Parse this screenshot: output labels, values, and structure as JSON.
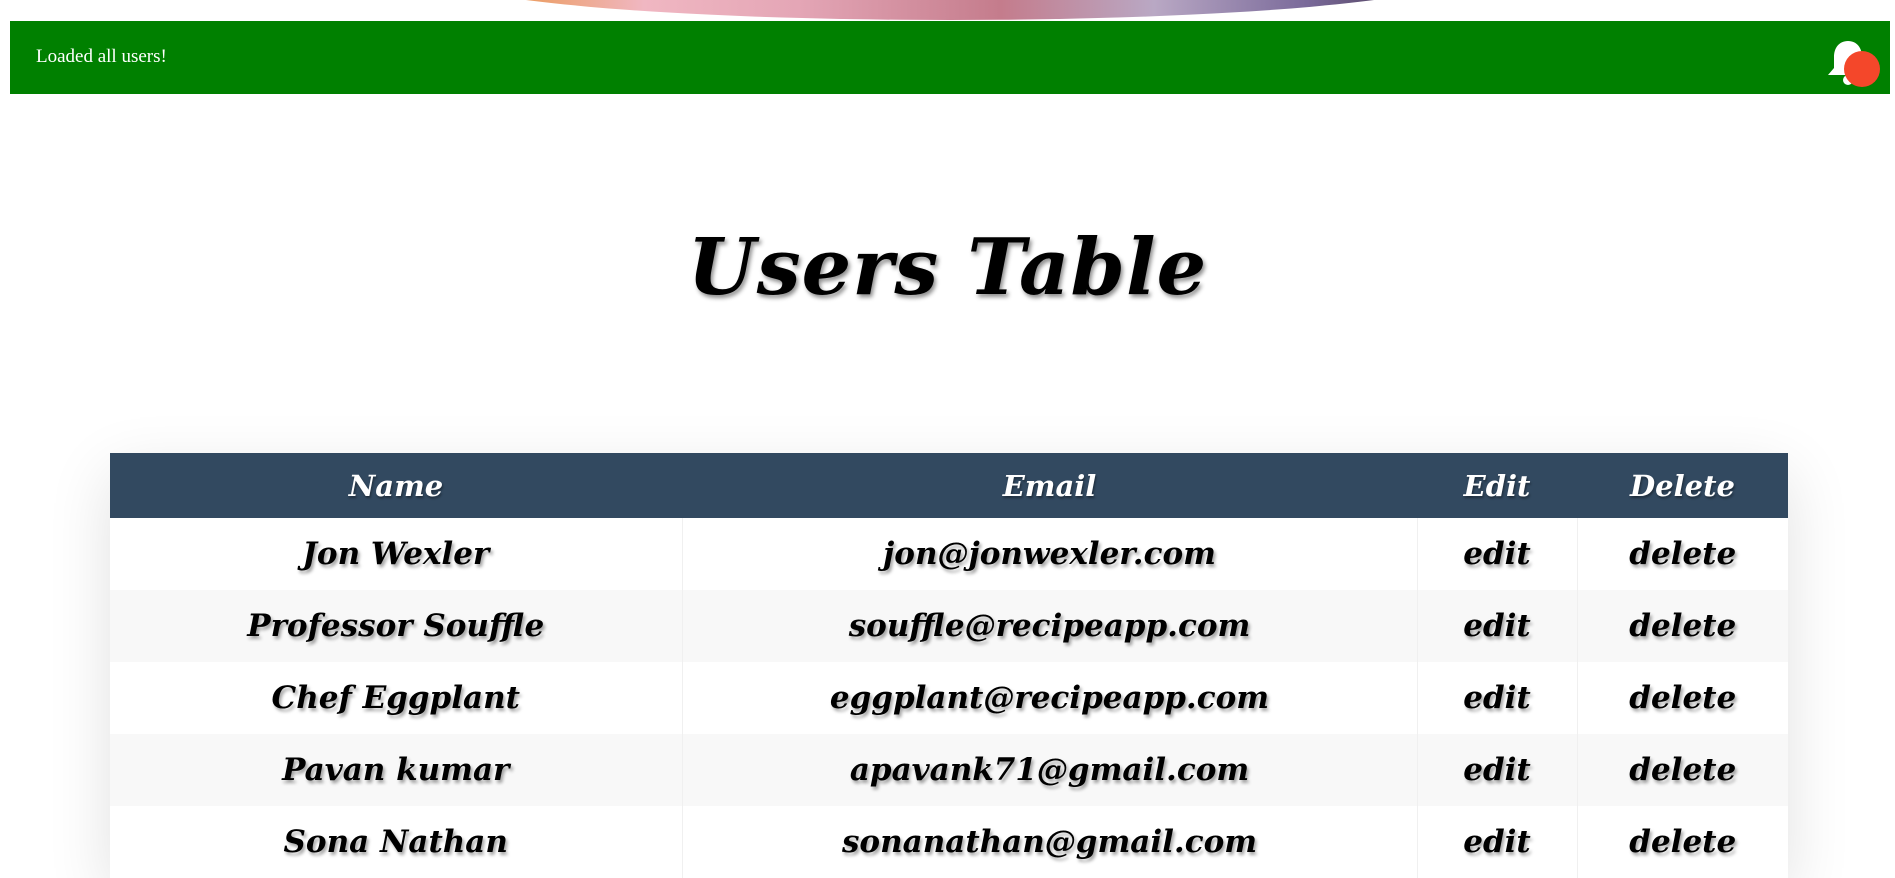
{
  "flash": {
    "message": "Loaded all users!",
    "color": "#008000",
    "badge_color": "#f4472a"
  },
  "page_title": "Users Table",
  "table": {
    "header_color": "#324960",
    "columns": [
      "Name",
      "Email",
      "Edit",
      "Delete"
    ],
    "rows": [
      {
        "name": "Jon Wexler",
        "email": "jon@jonwexler.com",
        "edit": "edit",
        "delete": "delete"
      },
      {
        "name": "Professor Souffle",
        "email": "souffle@recipeapp.com",
        "edit": "edit",
        "delete": "delete"
      },
      {
        "name": "Chef Eggplant",
        "email": "eggplant@recipeapp.com",
        "edit": "edit",
        "delete": "delete"
      },
      {
        "name": "Pavan kumar",
        "email": "apavank71@gmail.com",
        "edit": "edit",
        "delete": "delete"
      },
      {
        "name": "Sona Nathan",
        "email": "sonanathan@gmail.com",
        "edit": "edit",
        "delete": "delete"
      }
    ]
  },
  "icons": {
    "notification": "bell-icon"
  }
}
